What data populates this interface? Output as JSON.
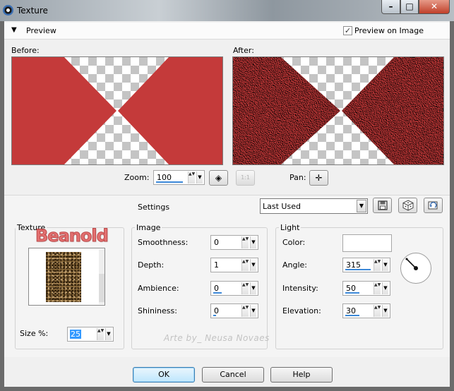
{
  "window": {
    "title": "Texture",
    "min_glyph": "–",
    "max_glyph": "□",
    "close_glyph": "✕"
  },
  "preview": {
    "section_label": "Preview",
    "collapse_glyph": "▼",
    "preview_on_image_label": "Preview on Image",
    "preview_on_image_checked": true,
    "check_glyph": "✓",
    "before_label": "Before:",
    "after_label": "After:",
    "zoom_label": "Zoom:",
    "zoom_value": "100",
    "pan_label": "Pan:",
    "one_to_one_label": "1:1",
    "colors": {
      "shape": "#c43a3a",
      "shape_textured": "#c53b3b"
    }
  },
  "settings": {
    "label": "Settings",
    "preset_value": "Last Used"
  },
  "texture": {
    "title": "Texture",
    "logo_text": "Beanold",
    "size_label": "Size %:",
    "size_value": "25"
  },
  "image": {
    "title": "Image",
    "smoothness_label": "Smoothness:",
    "smoothness_value": "0",
    "depth_label": "Depth:",
    "depth_value": "1",
    "ambience_label": "Ambience:",
    "ambience_value": "0",
    "shininess_label": "Shininess:",
    "shininess_value": "0"
  },
  "light": {
    "title": "Light",
    "color_label": "Color:",
    "color_value": "#ffffff",
    "angle_label": "Angle:",
    "angle_value": "315",
    "intensity_label": "Intensity:",
    "intensity_value": "50",
    "elevation_label": "Elevation:",
    "elevation_value": "30"
  },
  "watermark": "Arte by_ Neusa Novaes",
  "buttons": {
    "ok": "OK",
    "cancel": "Cancel",
    "help": "Help"
  },
  "glyphs": {
    "spin_arrows": "▲▼",
    "drop": "▼",
    "pan": "✛",
    "fit": "◈"
  }
}
